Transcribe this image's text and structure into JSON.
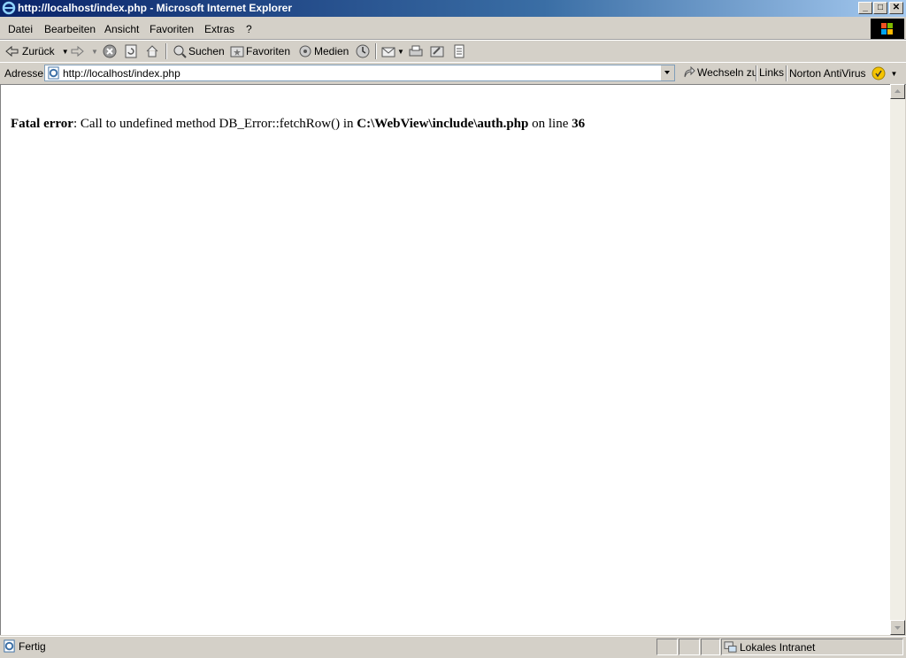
{
  "window": {
    "title": "http://localhost/index.php - Microsoft Internet Explorer",
    "controls": {
      "minimize": "_",
      "maximize": "□",
      "close": "✕"
    }
  },
  "menubar": {
    "items": [
      "Datei",
      "Bearbeiten",
      "Ansicht",
      "Favoriten",
      "Extras",
      "?"
    ]
  },
  "toolbar": {
    "back_label": "Zurück",
    "search_label": "Suchen",
    "favorites_label": "Favoriten",
    "media_label": "Medien"
  },
  "addressbar": {
    "label": "Adresse",
    "url": "http://localhost/index.php",
    "go_label": "Wechseln zu",
    "links_label": "Links",
    "norton_label": "Norton AntiVirus"
  },
  "content": {
    "error_label": "Fatal error",
    "error_mid": ": Call to undefined method DB_Error::fetchRow() in ",
    "error_file": "C:\\WebView\\include\\auth.php",
    "error_online": " on line ",
    "error_line": "36"
  },
  "statusbar": {
    "status": "Fertig",
    "zone": "Lokales Intranet"
  },
  "icons": [
    "ie-icon",
    "back-arrow-icon",
    "forward-arrow-icon",
    "stop-icon",
    "refresh-icon",
    "home-icon",
    "search-icon",
    "favorites-icon",
    "media-icon",
    "history-icon",
    "mail-icon",
    "print-icon",
    "edit-icon",
    "discuss-icon",
    "page-icon",
    "go-arrow-icon",
    "norton-icon",
    "windows-logo-icon",
    "intranet-icon"
  ]
}
